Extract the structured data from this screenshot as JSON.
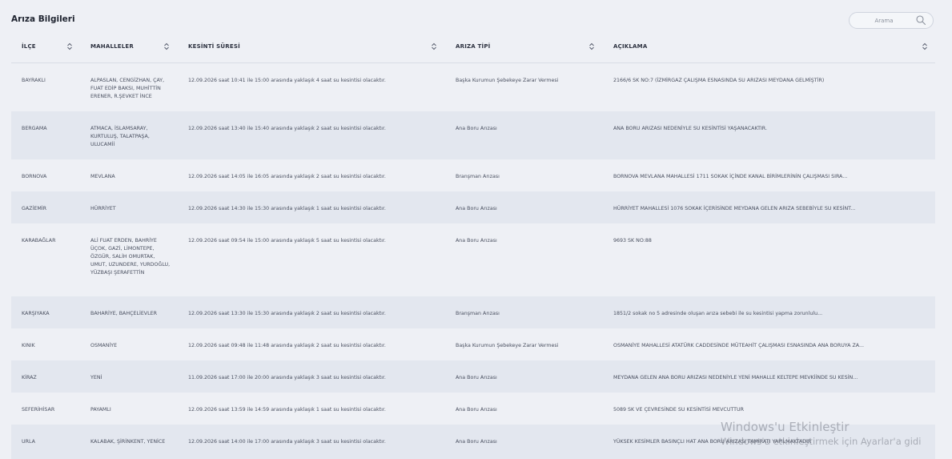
{
  "panel": {
    "title": "Arıza Bilgileri"
  },
  "search": {
    "placeholder": "Arama"
  },
  "columns": [
    "İLÇE",
    "MAHALLELER",
    "KESİNTİ SÜRESİ",
    "ARIZA TİPİ",
    "AÇIKLAMA"
  ],
  "rows": [
    {
      "ilce": "BAYRAKLI",
      "mahalleler": "ALPASLAN, CENGİZHAN, ÇAY, FUAT EDİP BAKSI, MUHİTTİN ERENER, R.ŞEVKET İNCE",
      "sure": "12.09.2026 saat 10:41 ile 15:00 arasında yaklaşık 4 saat su kesintisi olacaktır.",
      "tip": "Başka Kurumun Şebekeye Zarar Vermesi",
      "aciklama": "2166/6 SK NO:7 (İZMİRGAZ ÇALIŞMA ESNASINDA SU ARIZASI MEYDANA GELMİŞTİR)"
    },
    {
      "ilce": "BERGAMA",
      "mahalleler": "ATMACA, İSLAMSARAY, KURTULUŞ, TALATPAŞA, ULUCAMİİ",
      "sure": "12.09.2026 saat 13:40 ile 15:40 arasında yaklaşık 2 saat su kesintisi olacaktır.",
      "tip": "Ana Boru Arızası",
      "aciklama": "ANA BORU ARIZASI NEDENİYLE SU KESİNTİSİ YAŞANACAKTIR."
    },
    {
      "ilce": "BORNOVA",
      "mahalleler": "MEVLANA",
      "sure": "12.09.2026 saat 14:05 ile 16:05 arasında yaklaşık 2 saat su kesintisi olacaktır.",
      "tip": "Branşman Arızası",
      "aciklama": "BORNOVA MEVLANA MAHALLESİ 1711 SOKAK İÇİNDE KANAL BİRİMLERİNİN ÇALIŞMASI SIRA..."
    },
    {
      "ilce": "GAZİEMİR",
      "mahalleler": "HÜRRİYET",
      "sure": "12.09.2026 saat 14:30 ile 15:30 arasında yaklaşık 1 saat su kesintisi olacaktır.",
      "tip": "Ana Boru Arızası",
      "aciklama": "HÜRRİYET MAHALLESİ 1076 SOKAK İÇERİSİNDE MEYDANA GELEN ARIZA SEBEBİYLE SU KESİNT..."
    },
    {
      "ilce": "KARABAĞLAR",
      "mahalleler": "ALİ FUAT ERDEN, BAHRİYE ÜÇOK, GAZİ, LİMONTEPE, ÖZGÜR, SALİH OMURTAK, UMUT, UZUNDERE, YURDOĞLU, YÜZBAŞI ŞERAFETTİN",
      "sure": "12.09.2026 saat 09:54 ile 15:00 arasında yaklaşık 5 saat su kesintisi olacaktır.",
      "tip": "Ana Boru Arızası",
      "aciklama": "9693 SK NO:88"
    },
    {
      "ilce": "KARŞIYAKA",
      "mahalleler": "BAHARİYE, BAHÇELİEVLER",
      "sure": "12.09.2026 saat 13:30 ile 15:30 arasında yaklaşık 2 saat su kesintisi olacaktır.",
      "tip": "Branşman Arızası",
      "aciklama": "1851/2 sokak no 5 adresinde oluşan arıza sebebi ile su kesintisi yapma zorunlulu..."
    },
    {
      "ilce": "KINIK",
      "mahalleler": "OSMANİYE",
      "sure": "12.09.2026 saat 09:48 ile 11:48 arasında yaklaşık 2 saat su kesintisi olacaktır.",
      "tip": "Başka Kurumun Şebekeye Zarar Vermesi",
      "aciklama": "OSMANİYE MAHALLESİ ATATÜRK CADDESİNDE MÜTEAHİT ÇALIŞMASI ESNASINDA ANA BORUYA ZA..."
    },
    {
      "ilce": "KİRAZ",
      "mahalleler": "YENİ",
      "sure": "11.09.2026 saat 17:00 ile 20:00 arasında yaklaşık 3 saat su kesintisi olacaktır.",
      "tip": "Ana Boru Arızası",
      "aciklama": "MEYDANA GELEN ANA BORU ARIZASI NEDENİYLE YENİ MAHALLE KELTEPE MEVKİİNDE SU KESİN..."
    },
    {
      "ilce": "SEFERİHİSAR",
      "mahalleler": "PAYAMLI",
      "sure": "12.09.2026 saat 13:59 ile 14:59 arasında yaklaşık 1 saat su kesintisi olacaktır.",
      "tip": "Ana Boru Arızası",
      "aciklama": "5089 SK VE ÇEVRESİNDE SU KESİNTİSİ MEVCUTTUR"
    },
    {
      "ilce": "URLA",
      "mahalleler": "KALABAK, ŞİRİNKENT, YENİCE",
      "sure": "12.09.2026 saat 14:00 ile 17:00 arasında yaklaşık 3 saat su kesintisi olacaktır.",
      "tip": "Ana Boru Arızası",
      "aciklama": "YÜKSEK KESİMLER BASINÇLI HAT ANA BORU ARIZASI TAMİRATI YAPILMAKTADIR"
    }
  ],
  "watermark": {
    "line1": "Windows'u Etkinleştir",
    "line2": "Windows'u etkinleştirmek için Ayarlar'a gidi"
  },
  "icons": {
    "search": "search-icon",
    "sort": "sort-icon"
  }
}
